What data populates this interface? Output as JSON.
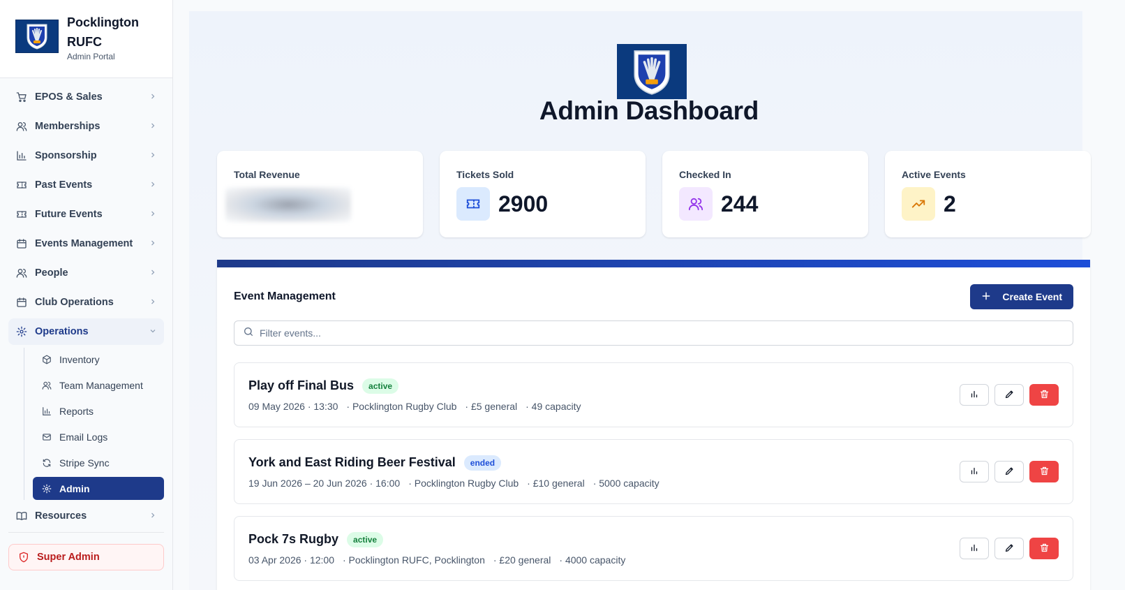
{
  "brand": {
    "name": "Pocklington RUFC",
    "sub": "Admin Portal"
  },
  "nav": [
    {
      "label": "EPOS & Sales",
      "icon": "cart-icon"
    },
    {
      "label": "Memberships",
      "icon": "users-icon"
    },
    {
      "label": "Sponsorship",
      "icon": "bar-chart-icon"
    },
    {
      "label": "Past Events",
      "icon": "ticket-icon"
    },
    {
      "label": "Future Events",
      "icon": "ticket-icon"
    },
    {
      "label": "Events Management",
      "icon": "calendar-icon"
    },
    {
      "label": "People",
      "icon": "users-icon"
    },
    {
      "label": "Club Operations",
      "icon": "calendar-icon"
    },
    {
      "label": "Operations",
      "icon": "gear-icon"
    }
  ],
  "subnav": [
    {
      "label": "Inventory",
      "icon": "package-icon"
    },
    {
      "label": "Team Management",
      "icon": "users-icon"
    },
    {
      "label": "Reports",
      "icon": "bar-chart-icon"
    },
    {
      "label": "Email Logs",
      "icon": "mail-icon"
    },
    {
      "label": "Stripe Sync",
      "icon": "refresh-icon"
    },
    {
      "label": "Admin",
      "icon": "gear-icon"
    }
  ],
  "resources": {
    "label": "Resources",
    "icon": "book-icon"
  },
  "super_admin": {
    "label": "Super Admin",
    "icon": "shield-icon"
  },
  "page_title": "Admin Dashboard",
  "stats": [
    {
      "label": "Total Revenue",
      "value": "",
      "blurred": true
    },
    {
      "label": "Tickets Sold",
      "value": "2900",
      "icon": "ticket-icon",
      "bg": "#dbeafe",
      "fg": "#1d4ed8"
    },
    {
      "label": "Checked In",
      "value": "244",
      "icon": "users-icon",
      "bg": "#f3e8ff",
      "fg": "#9333ea"
    },
    {
      "label": "Active Events",
      "value": "2",
      "icon": "trending-up-icon",
      "bg": "#fef3c7",
      "fg": "#d97706"
    }
  ],
  "events_section": {
    "title": "Event Management",
    "create_label": "Create Event",
    "search_placeholder": "Filter events..."
  },
  "events": [
    {
      "name": "Play off Final Bus",
      "status": "active",
      "date": "09 May 2026 · 13:30",
      "venue": "· Pocklington Rugby Club",
      "price": "· £5 general",
      "capacity": "· 49 capacity"
    },
    {
      "name": "York and East Riding Beer Festival",
      "status": "ended",
      "date": "19 Jun 2026 – 20 Jun 2026 · 16:00",
      "venue": "· Pocklington Rugby Club",
      "price": "· £10 general",
      "capacity": "· 5000 capacity"
    },
    {
      "name": "Pock 7s Rugby",
      "status": "active",
      "date": "03 Apr 2026 · 12:00",
      "venue": "· Pocklington RUFC, Pocklington",
      "price": "· £20 general",
      "capacity": "· 4000 capacity"
    }
  ],
  "colors": {
    "primary": "#1e3a8a",
    "danger": "#ef4444",
    "crest": "#0b3a7e"
  }
}
